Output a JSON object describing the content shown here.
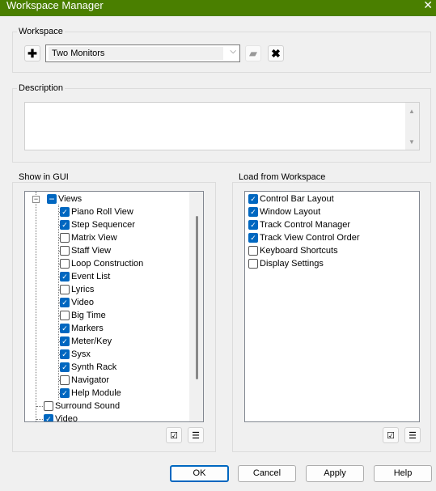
{
  "window": {
    "title": "Workspace Manager",
    "close": "✕"
  },
  "workspace": {
    "label": "Workspace",
    "selected": "Two Monitors",
    "add_icon": "plus-icon",
    "save_icon": "save-icon",
    "delete_icon": "delete-icon"
  },
  "description": {
    "label": "Description",
    "value": ""
  },
  "show_in_gui": {
    "label": "Show in GUI",
    "root": {
      "label": "Views",
      "state": "partial"
    },
    "items": [
      {
        "label": "Piano Roll View",
        "checked": true
      },
      {
        "label": "Step Sequencer",
        "checked": true
      },
      {
        "label": "Matrix View",
        "checked": false
      },
      {
        "label": "Staff View",
        "checked": false
      },
      {
        "label": "Loop Construction",
        "checked": false
      },
      {
        "label": "Event List",
        "checked": true
      },
      {
        "label": "Lyrics",
        "checked": false
      },
      {
        "label": "Video",
        "checked": true
      },
      {
        "label": "Big Time",
        "checked": false
      },
      {
        "label": "Markers",
        "checked": true
      },
      {
        "label": "Meter/Key",
        "checked": true
      },
      {
        "label": "Sysx",
        "checked": true
      },
      {
        "label": "Synth Rack",
        "checked": true
      },
      {
        "label": "Navigator",
        "checked": false
      },
      {
        "label": "Help Module",
        "checked": true
      }
    ],
    "top_items": [
      {
        "label": "Surround Sound",
        "checked": false
      },
      {
        "label": "Video",
        "checked": true
      }
    ]
  },
  "load_from_workspace": {
    "label": "Load from Workspace",
    "items": [
      {
        "label": "Control Bar Layout",
        "checked": true
      },
      {
        "label": "Window Layout",
        "checked": true
      },
      {
        "label": "Track Control Manager",
        "checked": true
      },
      {
        "label": "Track View Control Order",
        "checked": true
      },
      {
        "label": "Keyboard Shortcuts",
        "checked": false
      },
      {
        "label": "Display Settings",
        "checked": false
      }
    ]
  },
  "buttons": {
    "ok": "OK",
    "cancel": "Cancel",
    "apply": "Apply",
    "help": "Help"
  },
  "colors": {
    "title_bar": "#4a7f00",
    "checkbox": "#0067c0"
  }
}
